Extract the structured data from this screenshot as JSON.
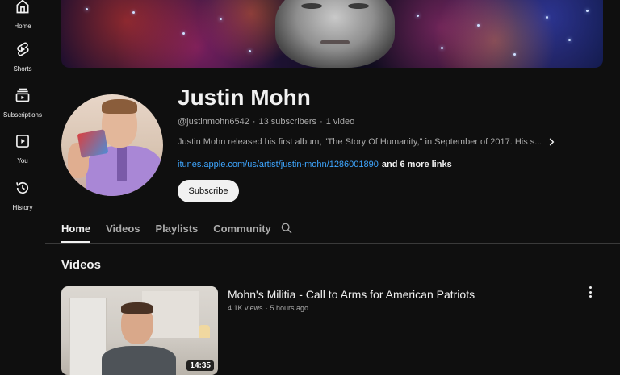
{
  "sidebar": {
    "items": [
      {
        "label": "Home",
        "icon": "home-icon"
      },
      {
        "label": "Shorts",
        "icon": "shorts-icon"
      },
      {
        "label": "Subscriptions",
        "icon": "subscriptions-icon"
      },
      {
        "label": "You",
        "icon": "you-icon"
      },
      {
        "label": "History",
        "icon": "history-icon"
      }
    ]
  },
  "channel": {
    "name": "Justin Mohn",
    "handle": "@justinmohn6542",
    "subscribers": "13 subscribers",
    "video_count": "1 video",
    "separator": "·",
    "description": "Justin Mohn released his first album, \"The Story Of Humanity,\" in September of 2017. His s...",
    "link": "itunes.apple.com/us/artist/justin-mohn/1286001890",
    "more_links": "and 6 more links",
    "subscribe_label": "Subscribe"
  },
  "tabs": [
    {
      "label": "Home",
      "active": true
    },
    {
      "label": "Videos",
      "active": false
    },
    {
      "label": "Playlists",
      "active": false
    },
    {
      "label": "Community",
      "active": false
    }
  ],
  "videos_section": {
    "title": "Videos",
    "items": [
      {
        "title": "Mohn's Militia - Call to Arms for American Patriots",
        "views": "4.1K views",
        "age": "5 hours ago",
        "duration": "14:35"
      }
    ]
  },
  "colors": {
    "background": "#0f0f0f",
    "text_primary": "#f1f1f1",
    "text_secondary": "#aaaaaa",
    "link": "#3ea6ff",
    "subscribe_bg": "#f1f1f1"
  }
}
